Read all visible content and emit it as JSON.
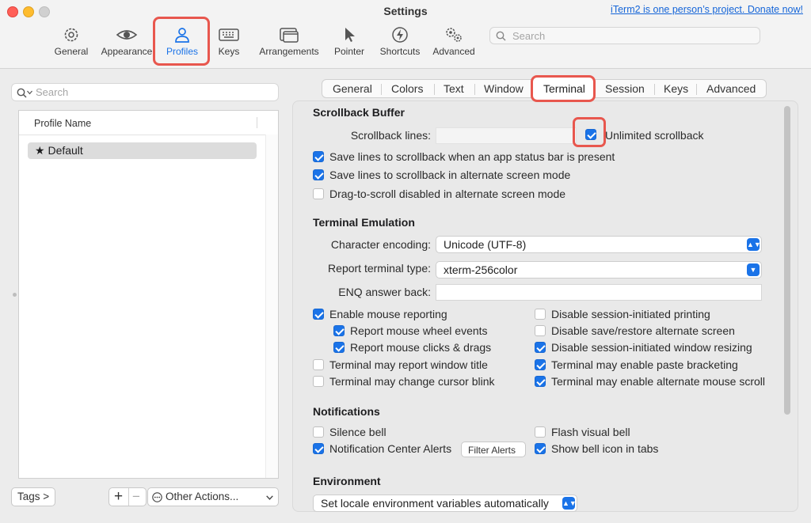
{
  "window": {
    "title": "Settings",
    "donate_link": "iTerm2 is one person’s project. Donate now!"
  },
  "toolbar": {
    "items": [
      {
        "label": "General",
        "icon": "gear-icon"
      },
      {
        "label": "Appearance",
        "icon": "eye-icon"
      },
      {
        "label": "Profiles",
        "icon": "person-icon",
        "active": true
      },
      {
        "label": "Keys",
        "icon": "keyboard-icon"
      },
      {
        "label": "Arrangements",
        "icon": "window-stack-icon"
      },
      {
        "label": "Pointer",
        "icon": "cursor-icon"
      },
      {
        "label": "Shortcuts",
        "icon": "bolt-icon"
      },
      {
        "label": "Advanced",
        "icon": "gears-icon"
      }
    ],
    "search_placeholder": "Search"
  },
  "profiles": {
    "search_placeholder": "Search",
    "column_header": "Profile Name",
    "rows": [
      {
        "name": "Default",
        "default": true
      }
    ],
    "tags_button": "Tags >",
    "add_button": "+",
    "remove_button": "−",
    "other_actions": "Other Actions..."
  },
  "tabs": {
    "items": [
      "General",
      "Colors",
      "Text",
      "Window",
      "Terminal",
      "Session",
      "Keys",
      "Advanced"
    ],
    "active": "Terminal"
  },
  "scrollback": {
    "heading": "Scrollback Buffer",
    "lines_label": "Scrollback lines:",
    "lines_value": "",
    "unlimited": {
      "label": "Unlimited scrollback",
      "checked": true
    },
    "save_status_bar": {
      "label": "Save lines to scrollback when an app status bar is present",
      "checked": true
    },
    "save_alternate": {
      "label": "Save lines to scrollback in alternate screen mode",
      "checked": true
    },
    "drag_disabled": {
      "label": "Drag-to-scroll disabled in alternate screen mode",
      "checked": false
    }
  },
  "emulation": {
    "heading": "Terminal Emulation",
    "encoding_label": "Character encoding:",
    "encoding_value": "Unicode (UTF-8)",
    "report_type_label": "Report terminal type:",
    "report_type_value": "xterm-256color",
    "enq_label": "ENQ answer back:",
    "enq_value": "",
    "left_options": [
      {
        "label": "Enable mouse reporting",
        "checked": true
      },
      {
        "label": "Report mouse wheel events",
        "checked": true
      },
      {
        "label": "Report mouse clicks & drags",
        "checked": true
      },
      {
        "label": "Terminal may report window title",
        "checked": false
      },
      {
        "label": "Terminal may change cursor blink",
        "checked": false
      }
    ],
    "right_options": [
      {
        "label": "Disable session-initiated printing",
        "checked": false
      },
      {
        "label": "Disable save/restore alternate screen",
        "checked": false
      },
      {
        "label": "Disable session-initiated window resizing",
        "checked": true
      },
      {
        "label": "Terminal may enable paste bracketing",
        "checked": true
      },
      {
        "label": "Terminal may enable alternate mouse scroll",
        "checked": true
      }
    ]
  },
  "notifications": {
    "heading": "Notifications",
    "silence_bell": {
      "label": "Silence bell",
      "checked": false
    },
    "flash_bell": {
      "label": "Flash visual bell",
      "checked": false
    },
    "center_alerts": {
      "label": "Notification Center Alerts",
      "checked": true
    },
    "filter_button": "Filter Alerts",
    "bell_icon_tabs": {
      "label": "Show bell icon in tabs",
      "checked": true
    }
  },
  "environment": {
    "heading": "Environment",
    "locale_value": "Set locale environment variables automatically"
  },
  "colors": {
    "accent": "#1a73e8",
    "highlight": "#e8574e"
  }
}
